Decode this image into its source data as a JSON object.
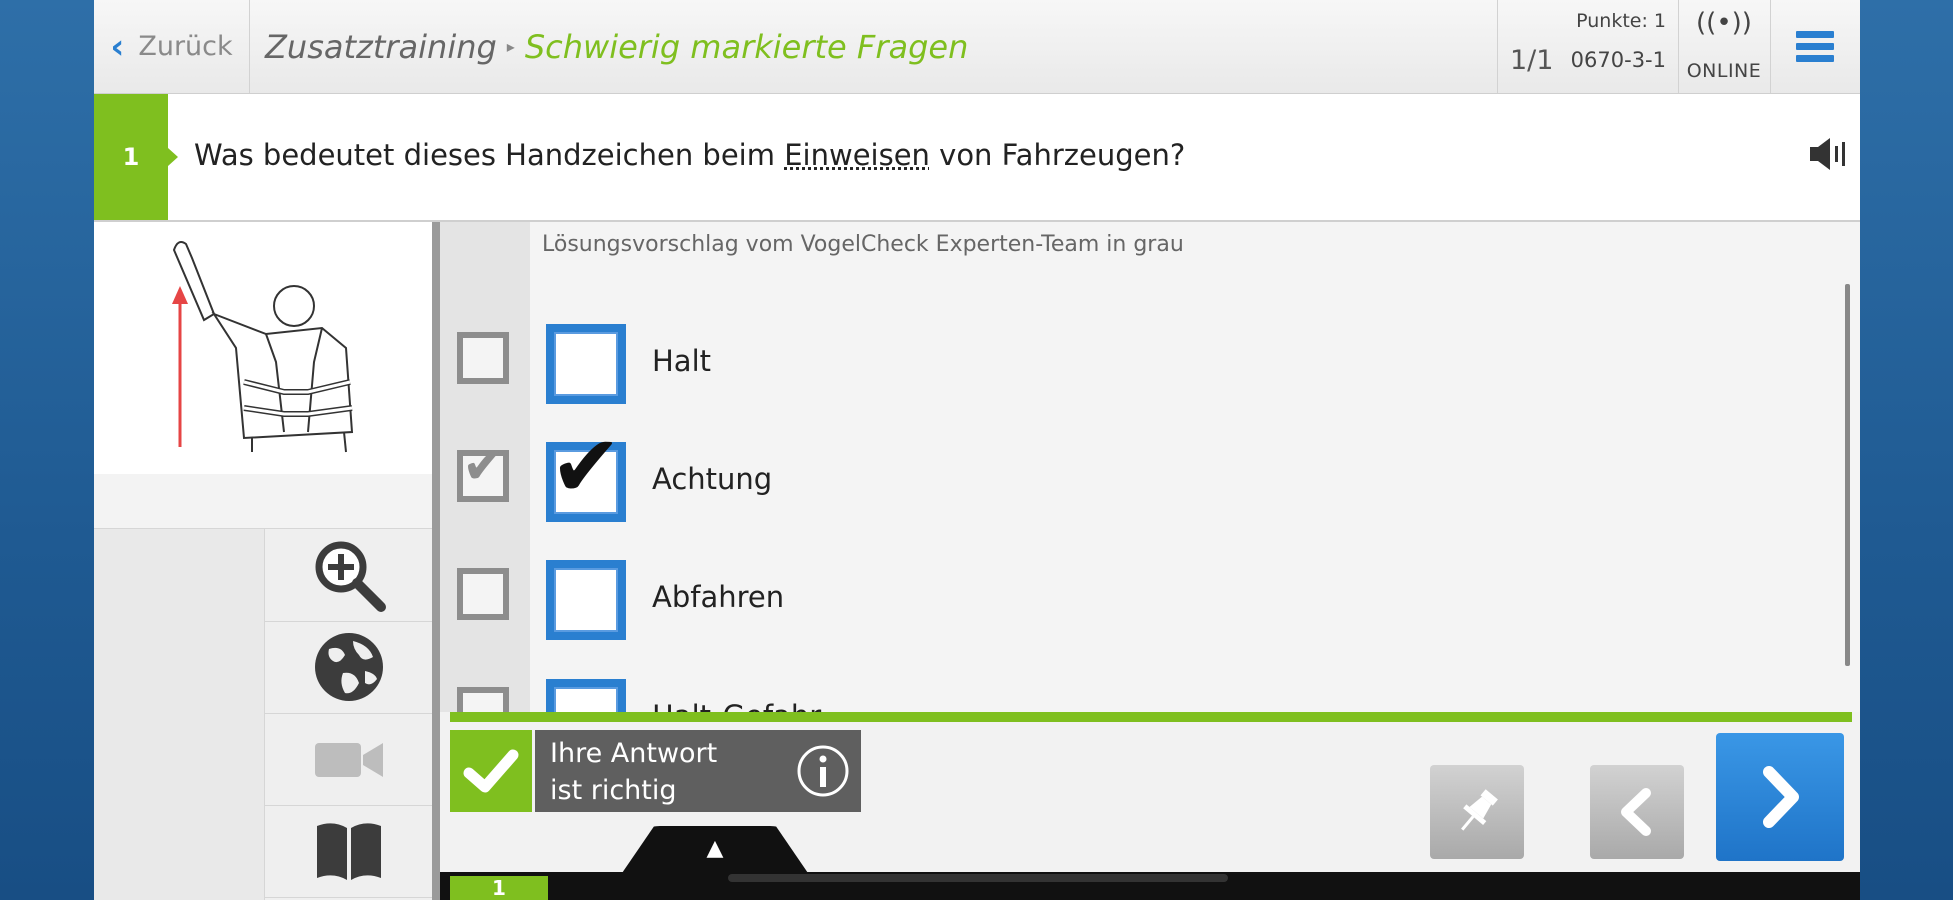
{
  "header": {
    "back_label": "Zurück",
    "breadcrumb": [
      "Zusatztraining",
      "Schwierig markierte Fragen"
    ],
    "points": "Punkte: 1",
    "question_counter": "1/1",
    "question_code": "0670-3-1",
    "status": "ONLINE",
    "online_icon": "((•))"
  },
  "question": {
    "number": "1",
    "text_before": "Was bedeutet dieses Handzeichen beim ",
    "text_link": "Einweisen",
    "text_after": " von Fahrzeugen?"
  },
  "answers": {
    "hint": "Lösungsvorschlag vom VogelCheck Experten-Team in grau",
    "items": [
      {
        "label": "Halt",
        "suggested": false,
        "checked": false
      },
      {
        "label": "Achtung",
        "suggested": true,
        "checked": true
      },
      {
        "label": "Abfahren",
        "suggested": false,
        "checked": false
      },
      {
        "label": "Halt-Gefahr",
        "suggested": false,
        "checked": false
      }
    ]
  },
  "result": {
    "line1": "Ihre Antwort",
    "line2": "ist richtig"
  },
  "footer": {
    "page": "1",
    "expand_glyph": "▲"
  },
  "tools": [
    "zoom-in-icon",
    "globe-icon",
    "video-camera-icon",
    "book-icon"
  ],
  "colors": {
    "accent_green": "#7fbf1f",
    "accent_blue": "#2a7fd0",
    "background_blue": "#1f5a92"
  }
}
